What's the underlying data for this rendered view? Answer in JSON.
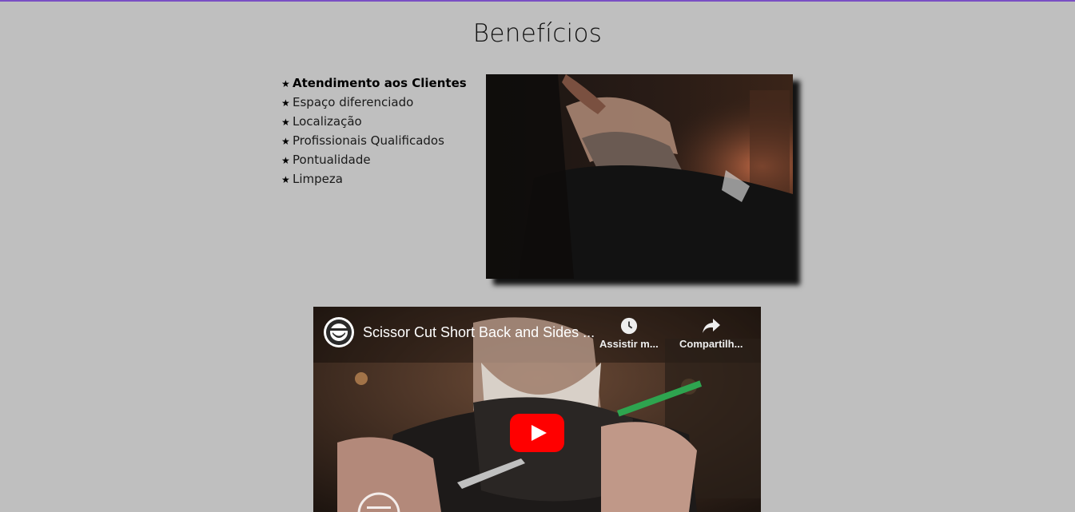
{
  "page": {
    "title": "Benefícios",
    "accent_color": "#7a4fc4"
  },
  "benefits": [
    {
      "label": "Atendimento aos Clientes",
      "icon": "star-icon"
    },
    {
      "label": "Espaço diferenciado",
      "icon": "star-icon"
    },
    {
      "label": "Localização",
      "icon": "star-icon"
    },
    {
      "label": "Profissionais Qualificados",
      "icon": "star-icon"
    },
    {
      "label": "Pontualidade",
      "icon": "star-icon"
    },
    {
      "label": "Limpeza",
      "icon": "star-icon"
    }
  ],
  "video": {
    "title": "Scissor Cut Short Back and Sides ...",
    "watch_later_label": "Assistir m...",
    "share_label": "Compartilh...",
    "play_color": "#ff0000"
  }
}
